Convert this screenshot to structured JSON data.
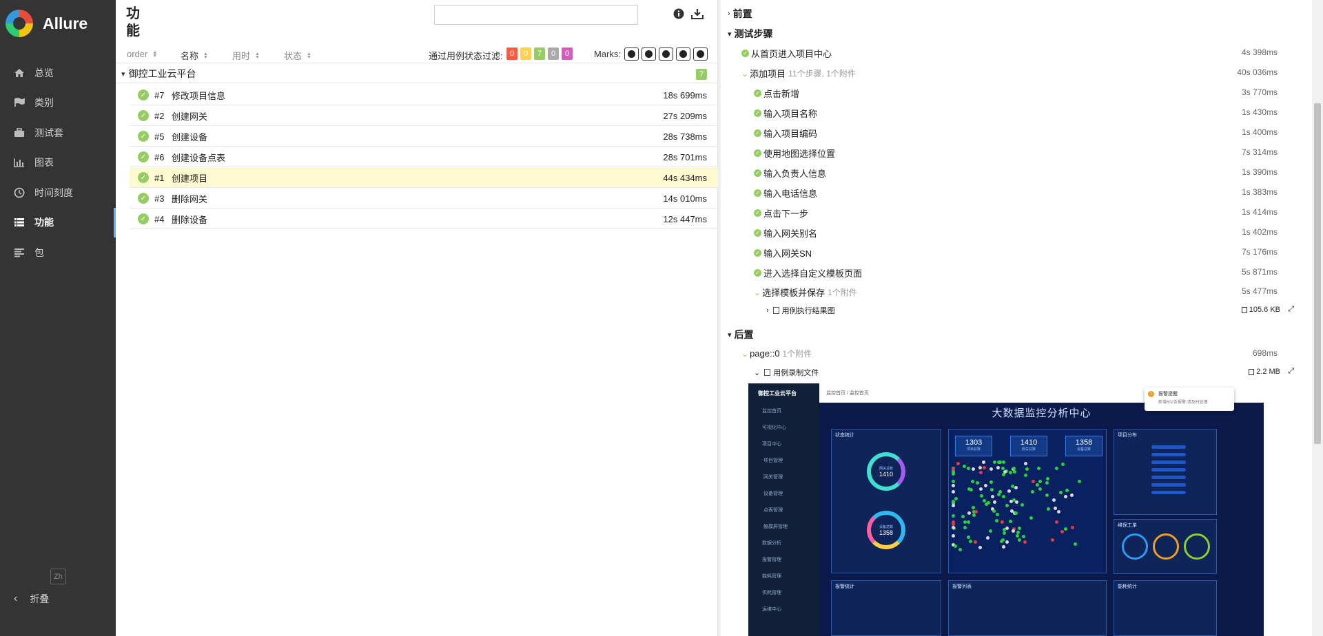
{
  "sidebar": {
    "brand": "Allure",
    "items": [
      {
        "label": "总览",
        "icon": "home-icon"
      },
      {
        "label": "类别",
        "icon": "flag-icon"
      },
      {
        "label": "测试套",
        "icon": "briefcase-icon"
      },
      {
        "label": "图表",
        "icon": "bar-chart-icon"
      },
      {
        "label": "时间刻度",
        "icon": "clock-icon"
      },
      {
        "label": "功能",
        "icon": "list-icon"
      },
      {
        "label": "包",
        "icon": "align-left-icon"
      }
    ],
    "active_item": "功能",
    "lang": "Zh",
    "collapse_label": "折叠"
  },
  "tree": {
    "title": "功能",
    "search_value": "",
    "columns": [
      "order",
      "名称",
      "用时",
      "状态"
    ],
    "filter_label": "通过用例状态过滤:",
    "status_counts": [
      {
        "value": "0",
        "color": "#fd5a3e"
      },
      {
        "value": "0",
        "color": "#ffd050"
      },
      {
        "value": "7",
        "color": "#97cc64"
      },
      {
        "value": "0",
        "color": "#aaaaaa"
      },
      {
        "value": "0",
        "color": "#d35ebe"
      }
    ],
    "marks_label": "Marks:",
    "group": {
      "label": "御控工业云平台",
      "count": "7"
    },
    "rows": [
      {
        "order": "#7",
        "name": "修改项目信息",
        "duration": "18s 699ms"
      },
      {
        "order": "#2",
        "name": "创建网关",
        "duration": "27s 209ms"
      },
      {
        "order": "#5",
        "name": "创建设备",
        "duration": "28s 738ms"
      },
      {
        "order": "#6",
        "name": "创建设备点表",
        "duration": "28s 701ms"
      },
      {
        "order": "#1",
        "name": "创建项目",
        "duration": "44s 434ms"
      },
      {
        "order": "#3",
        "name": "删除网关",
        "duration": "14s 010ms"
      },
      {
        "order": "#4",
        "name": "删除设备",
        "duration": "12s 447ms"
      }
    ],
    "selected_order": "#1"
  },
  "detail": {
    "setup_label": "前置",
    "steps_label": "测试步骤",
    "teardown_label": "后置",
    "steps": [
      {
        "name": "从首页进入项目中心",
        "meta": "",
        "duration": "4s 398ms",
        "level": 0
      },
      {
        "name": "添加项目",
        "meta": "11个步骤, 1个附件",
        "duration": "40s 036ms",
        "level": 0,
        "expanded": true
      },
      {
        "name": "点击新增",
        "meta": "",
        "duration": "3s 770ms",
        "level": 1
      },
      {
        "name": "输入项目名称",
        "meta": "",
        "duration": "1s 430ms",
        "level": 1
      },
      {
        "name": "输入项目编码",
        "meta": "",
        "duration": "1s 400ms",
        "level": 1
      },
      {
        "name": "使用地图选择位置",
        "meta": "",
        "duration": "7s 314ms",
        "level": 1
      },
      {
        "name": "输入负责人信息",
        "meta": "",
        "duration": "1s 390ms",
        "level": 1
      },
      {
        "name": "输入电话信息",
        "meta": "",
        "duration": "1s 383ms",
        "level": 1
      },
      {
        "name": "点击下一步",
        "meta": "",
        "duration": "1s 414ms",
        "level": 1
      },
      {
        "name": "输入网关别名",
        "meta": "",
        "duration": "1s 402ms",
        "level": 1
      },
      {
        "name": "输入网关SN",
        "meta": "",
        "duration": "7s 176ms",
        "level": 1
      },
      {
        "name": "进入选择自定义模板页面",
        "meta": "",
        "duration": "5s 871ms",
        "level": 1
      },
      {
        "name": "选择模板并保存",
        "meta": "1个附件",
        "duration": "5s 477ms",
        "level": 1,
        "expanded": true
      }
    ],
    "step_attachment": {
      "name": "用例执行结果图",
      "size": "105.6 KB"
    },
    "teardown_step": {
      "name": "page::0",
      "meta": "1个附件",
      "duration": "698ms"
    },
    "teardown_attachment": {
      "name": "用例录制文件",
      "size": "2.2 MB"
    }
  },
  "preview": {
    "brand": "御控工业云平台",
    "breadcrumb": "监控首页 / 监控首页",
    "title": "大数据监控分析中心",
    "menu": [
      "监控首页",
      "可视化中心",
      "项目中心",
      "项目管理",
      "网关管理",
      "设备管理",
      "点表管理",
      "触摸屏管理",
      "数据分析",
      "报警管理",
      "能耗管理",
      "供耗管理",
      "运维中心"
    ],
    "kpis": [
      {
        "value": "1303",
        "label": "项目总数"
      },
      {
        "value": "1410",
        "label": "网关总数"
      },
      {
        "value": "1358",
        "label": "设备总数"
      }
    ],
    "rings": [
      {
        "value": "1410",
        "label": "网关总数"
      },
      {
        "value": "1358",
        "label": "设备总数"
      }
    ],
    "panels": [
      "状态统计",
      "项目分布",
      "维保工单",
      "报警统计",
      "报警列表",
      "能耗统计"
    ],
    "toast_title": "报警提醒",
    "toast_text": "新增602条报警,请及时处理"
  }
}
